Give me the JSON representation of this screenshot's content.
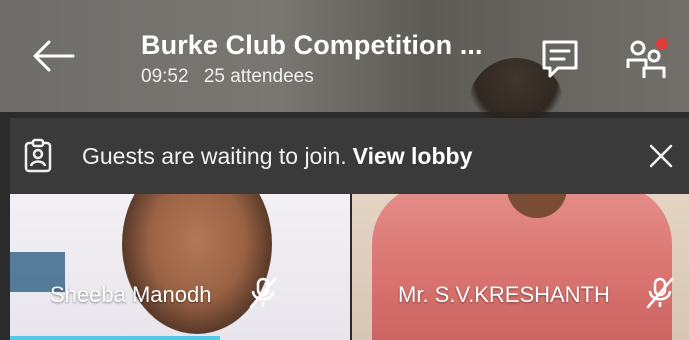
{
  "header": {
    "title": "Burke Club Competition ...",
    "time": "09:52",
    "attendees": "25 attendees"
  },
  "banner": {
    "message": "Guests are waiting to join.",
    "link": "View lobby"
  },
  "participants": [
    {
      "name": "Sheeba Manodh",
      "mic": "muted"
    },
    {
      "name": "Mr. S.V.KRESHANTH",
      "mic": "muted"
    }
  ],
  "colors": {
    "banner_bg": "#3a3a3a",
    "notification_dot": "#e23b3b",
    "text": "#ffffff"
  },
  "icons": {
    "back": "back-arrow-icon",
    "chat": "chat-icon",
    "people": "people-icon",
    "lobby": "clipboard-person-icon",
    "close": "close-icon",
    "mic_muted": "mic-muted-icon"
  }
}
